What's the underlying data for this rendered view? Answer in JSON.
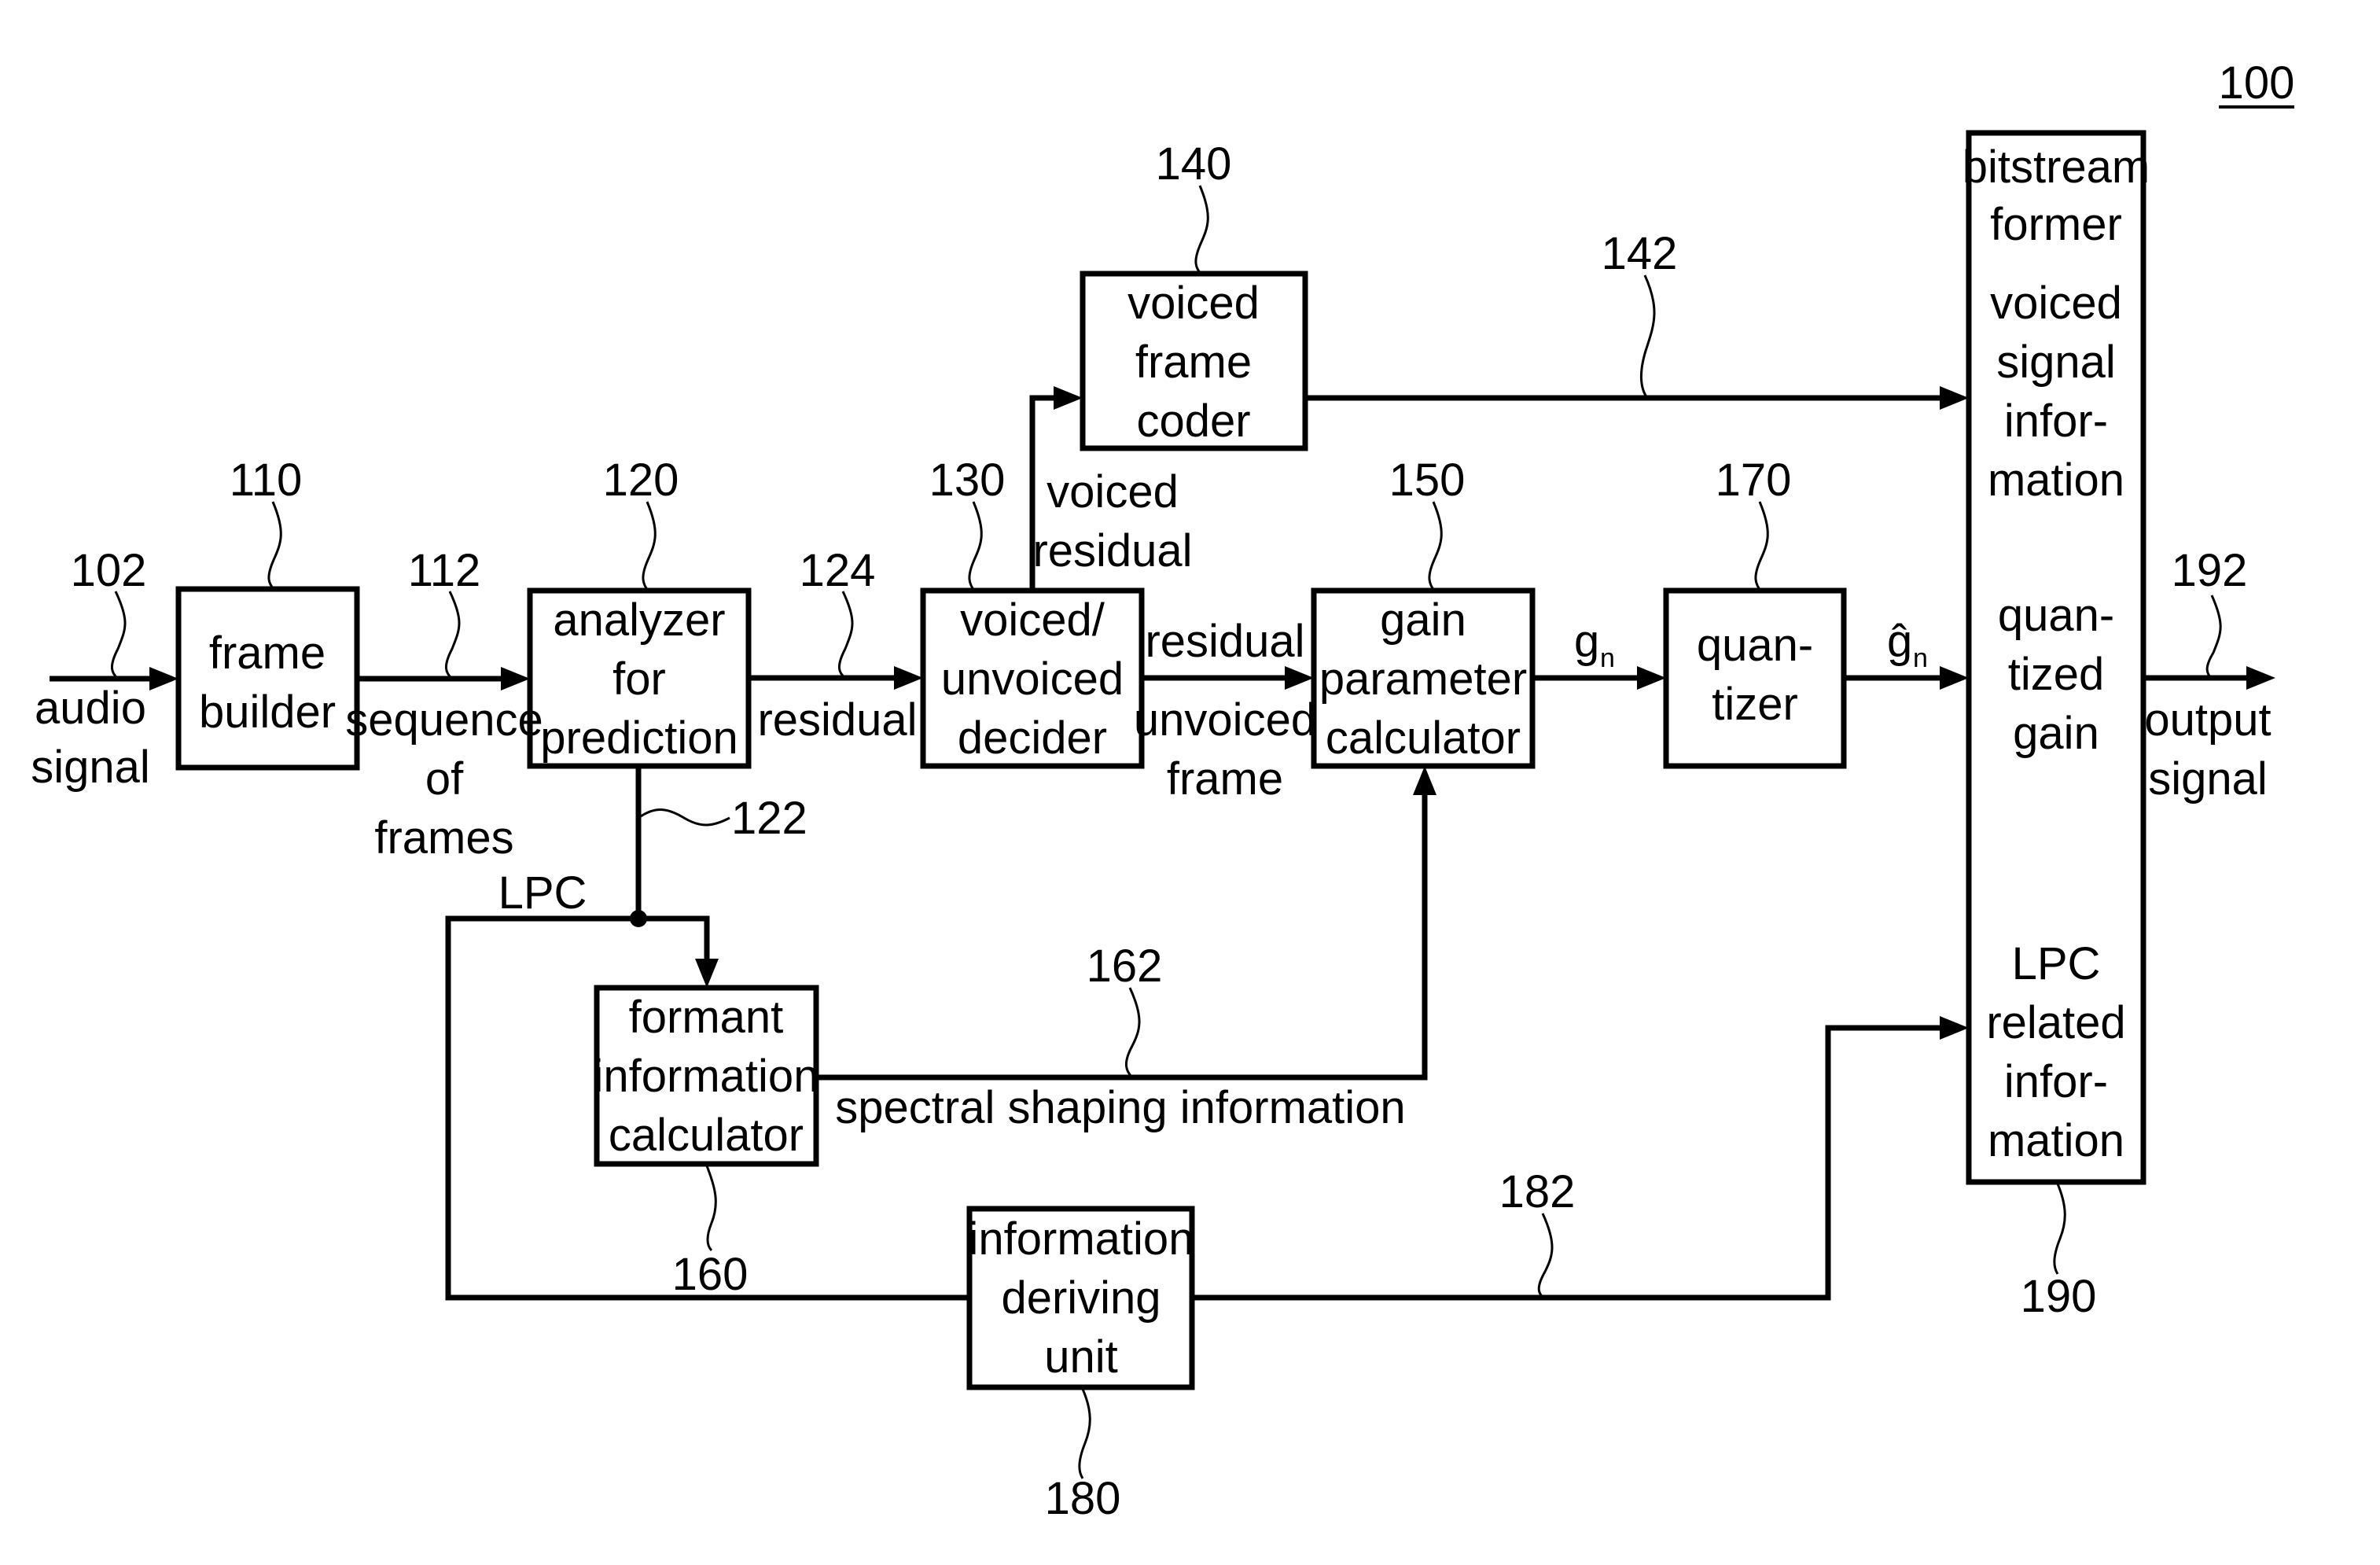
{
  "figure": {
    "number": "100",
    "blocks": {
      "frame_builder": {
        "ref": "110",
        "lines": [
          "frame",
          "builder"
        ]
      },
      "analyzer": {
        "ref": "120",
        "lines": [
          "analyzer",
          "for",
          "prediction"
        ]
      },
      "vuv_decider": {
        "ref": "130",
        "lines": [
          "voiced/",
          "unvoiced",
          "decider"
        ]
      },
      "voiced_coder": {
        "ref": "140",
        "lines": [
          "voiced",
          "frame",
          "coder"
        ]
      },
      "gain_calc": {
        "ref": "150",
        "lines": [
          "gain",
          "parameter",
          "calculator"
        ]
      },
      "formant_calc": {
        "ref": "160",
        "lines": [
          "formant",
          "information",
          "calculator"
        ]
      },
      "quantizer": {
        "ref": "170",
        "lines": [
          "quan-",
          "tizer"
        ]
      },
      "info_deriving": {
        "ref": "180",
        "lines": [
          "information",
          "deriving",
          "unit"
        ]
      },
      "bitstream_former": {
        "ref": "190",
        "title": [
          "bitstream",
          "former"
        ],
        "sections": {
          "voiced": [
            "voiced",
            "signal",
            "infor-",
            "mation"
          ],
          "gain": [
            "quan-",
            "tized",
            "gain"
          ],
          "lpc": [
            "LPC",
            "related",
            "infor-",
            "mation"
          ]
        }
      }
    },
    "signals": {
      "audio_in": {
        "ref": "102",
        "lines": [
          "audio",
          "signal"
        ]
      },
      "frames": {
        "ref": "112",
        "lines": [
          "sequence",
          "of",
          "frames"
        ]
      },
      "lpc": {
        "ref": "122",
        "label": "LPC"
      },
      "residual": {
        "ref": "124",
        "label": "residual"
      },
      "voiced_residual": {
        "lines": [
          "voiced",
          "residual"
        ]
      },
      "unvoiced_residual": {
        "top": "residual",
        "lines": [
          "unvoiced",
          "frame"
        ]
      },
      "voiced_info": {
        "ref": "142"
      },
      "spectral": {
        "ref": "162",
        "label": "spectral shaping information"
      },
      "gain": {
        "symbol": "g",
        "subscript": "n"
      },
      "quantized_gain": {
        "symbol": "ĝ",
        "subscript": "n"
      },
      "lpc_info": {
        "ref": "182"
      },
      "output": {
        "ref": "192",
        "lines": [
          "output",
          "signal"
        ]
      }
    }
  }
}
